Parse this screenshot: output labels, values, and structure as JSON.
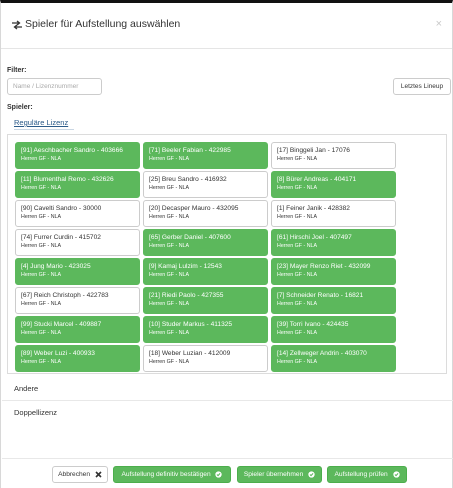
{
  "header": {
    "title": "Spieler für Aufstellung auswählen",
    "close_label": "×"
  },
  "filter": {
    "label": "Filter:",
    "placeholder": "Name / Lizenznummer",
    "lineup_button": "Letztes Lineup"
  },
  "players_label": "Spieler:",
  "tabs": {
    "regular": "Reguläre Lizenz",
    "other": "Andere",
    "double": "Doppellizenz"
  },
  "players": [
    {
      "name": "[91] Aeschbacher Sandro - 403666",
      "team": "Herren GF - NLA",
      "selected": true
    },
    {
      "name": "[71] Beeler Fabian - 422985",
      "team": "Herren GF - NLA",
      "selected": true
    },
    {
      "name": "[17] Binggeli Jan - 17076",
      "team": "Herren GF - NLA",
      "selected": false
    },
    {
      "name": "[11] Blumenthal Remo - 432626",
      "team": "Herren GF - NLA",
      "selected": true
    },
    {
      "name": "[25] Breu Sandro - 416932",
      "team": "Herren GF - NLA",
      "selected": false
    },
    {
      "name": "[8] Bürer Andreas - 404171",
      "team": "Herren GF - NLA",
      "selected": true
    },
    {
      "name": "[90] Cavelti Sandro - 30000",
      "team": "Herren GF - NLA",
      "selected": false
    },
    {
      "name": "[20] Decasper Mauro - 432095",
      "team": "Herren GF - NLA",
      "selected": false
    },
    {
      "name": "[1] Feiner Janik - 428382",
      "team": "Herren GF - NLA",
      "selected": false
    },
    {
      "name": "[74] Furrer Curdin - 415702",
      "team": "Herren GF - NLA",
      "selected": false
    },
    {
      "name": "[65] Gerber Daniel - 407600",
      "team": "Herren GF - NLA",
      "selected": true
    },
    {
      "name": "[61] Hirschi Joel - 407497",
      "team": "Herren GF - NLA",
      "selected": true
    },
    {
      "name": "[4] Jung Mario - 423025",
      "team": "Herren GF - NLA",
      "selected": true
    },
    {
      "name": "[9] Kamaj Lulzim - 12543",
      "team": "Herren GF - NLA",
      "selected": true
    },
    {
      "name": "[23] Mayer Renzo Riet - 432099",
      "team": "Herren GF - NLA",
      "selected": true
    },
    {
      "name": "[67] Reich Christoph - 422783",
      "team": "Herren GF - NLA",
      "selected": false
    },
    {
      "name": "[21] Riedi Paolo - 427355",
      "team": "Herren GF - NLA",
      "selected": true
    },
    {
      "name": "[7] Schneider Renato - 16821",
      "team": "Herren GF - NLA",
      "selected": true
    },
    {
      "name": "[99] Stucki Marcel - 409887",
      "team": "Herren GF - NLA",
      "selected": true
    },
    {
      "name": "[10] Studer Markus - 411325",
      "team": "Herren GF - NLA",
      "selected": true
    },
    {
      "name": "[39] Torri Ivano - 424435",
      "team": "Herren GF - NLA",
      "selected": true
    },
    {
      "name": "[89] Weber Luzi - 400933",
      "team": "Herren GF - NLA",
      "selected": true
    },
    {
      "name": "[18] Weber Luzian - 412009",
      "team": "Herren GF - NLA",
      "selected": false
    },
    {
      "name": "[14] Zellweger Andrin - 403070",
      "team": "Herren GF - NLA",
      "selected": true
    }
  ],
  "footer": {
    "cancel": "Abbrechen",
    "confirm": "Aufstellung definitiv bestätigen",
    "apply": "Spieler übernehmen",
    "check": "Aufstellung prüfen"
  },
  "colors": {
    "selected": "#5cb85c",
    "link": "#2a5a88"
  },
  "icons": {
    "title": "shuffle-icon",
    "cancel": "x-icon",
    "confirm": "check-circle-icon"
  }
}
